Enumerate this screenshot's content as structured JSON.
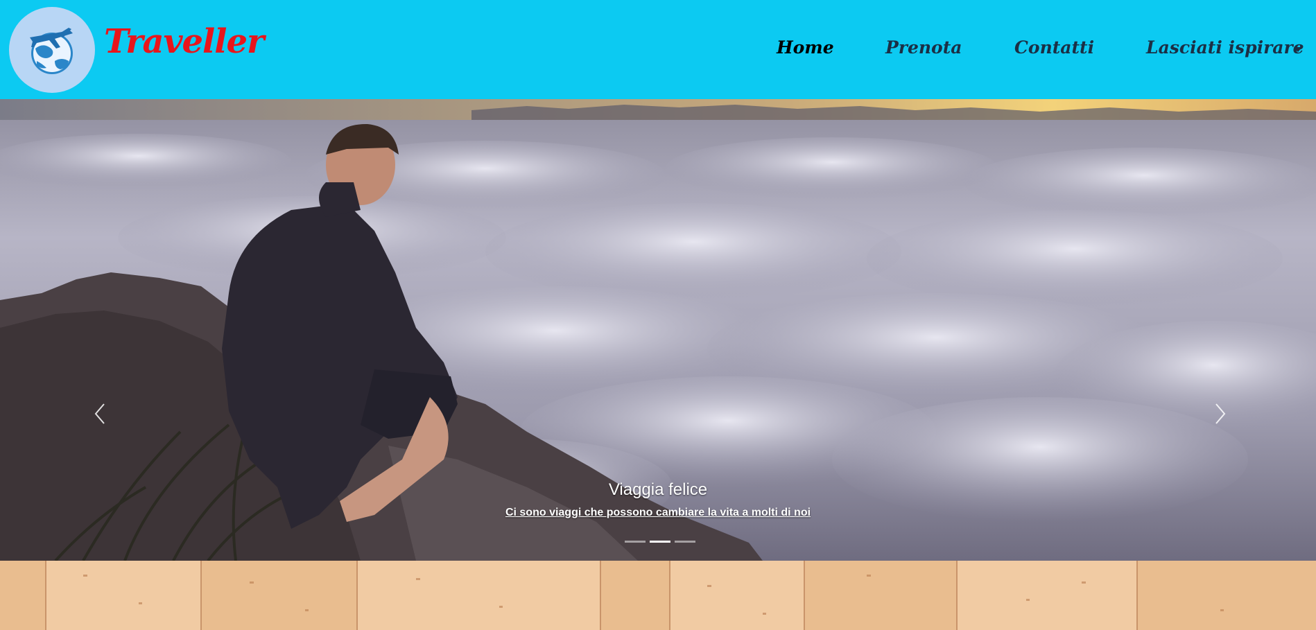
{
  "brand": {
    "name": "Traveller",
    "name_color": "#e8151b"
  },
  "navbar": {
    "background": "#0ccaf2",
    "items": [
      {
        "label": "Home",
        "active": true
      },
      {
        "label": "Prenota",
        "active": false
      },
      {
        "label": "Contatti",
        "active": false
      },
      {
        "label": "Lasciati ispirare",
        "active": false,
        "dropdown": true
      }
    ]
  },
  "carousel": {
    "caption_title": "Viaggia felice",
    "caption_text": "Ci sono viaggi che possono cambiare la vita a molti di noi",
    "slide_count": 3,
    "active_slide": 2,
    "prev_icon": "chevron-left-icon",
    "next_icon": "chevron-right-icon"
  }
}
